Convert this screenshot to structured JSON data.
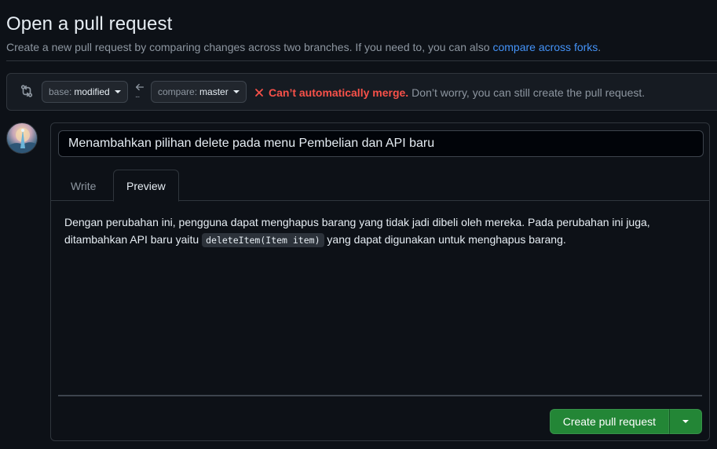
{
  "header": {
    "title": "Open a pull request",
    "subtitle": "Create a new pull request by comparing changes across two branches. If you need to, you can also",
    "compare_forks_link": "compare across forks",
    "subtitle_end": "."
  },
  "range": {
    "base_prefix": "base:",
    "base_branch": "modified",
    "compare_prefix": "compare:",
    "compare_branch": "master",
    "merge_status_title": "Can’t automatically merge.",
    "merge_status_hint": "Don’t worry, you can still create the pull request.",
    "arrow_dots": "..."
  },
  "composer": {
    "title_value": "Menambahkan pilihan delete pada menu Pembelian dan API baru",
    "tab_write": "Write",
    "tab_preview": "Preview",
    "body_part1": "Dengan perubahan ini, pengguna dapat menghapus barang yang tidak jadi dibeli oleh mereka. Pada perubahan ini juga, ditambahkan API baru yaitu ",
    "body_code": "deleteItem(Item item)",
    "body_part2": " yang dapat digunakan untuk menghapus barang.",
    "create_button": "Create pull request"
  },
  "colors": {
    "background": "#0d1117",
    "accent_link": "#4493f8",
    "danger": "#f85149",
    "primary_button": "#238636"
  },
  "icons": {
    "compare": "git-compare-icon",
    "arrow": "arrow-left-icon",
    "merge_error": "x-icon",
    "dropdown": "triangle-down-icon"
  }
}
